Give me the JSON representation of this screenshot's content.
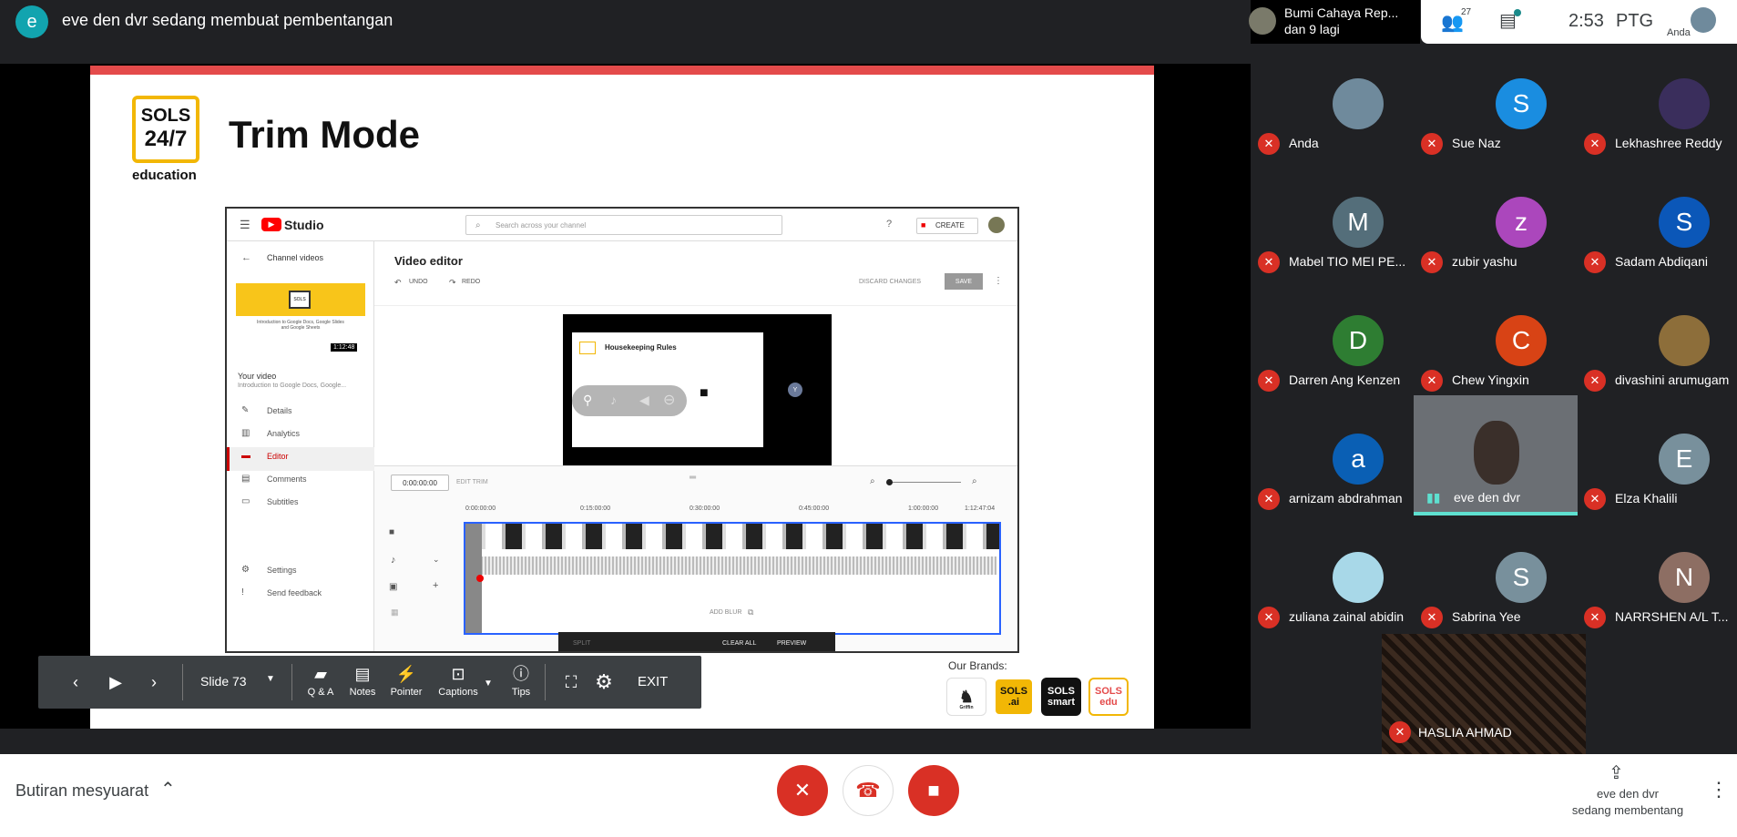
{
  "header": {
    "presenter_initial": "e",
    "presenter_title": "eve den dvr sedang membuat pembentangan"
  },
  "slide": {
    "logo_line1": "SOLS",
    "logo_line2": "24/7",
    "logo_caption": "education",
    "title": "Trim Mode",
    "brands_label": "Our Brands:",
    "brands": [
      "Griffin",
      "SOLS .ai",
      "SOLS smart",
      "SOLS edu"
    ],
    "studio": {
      "brand": "Studio",
      "search_placeholder": "Search across your channel",
      "create": "CREATE",
      "back": "Channel videos",
      "thumb_time": "1:12:48",
      "thumb_title": "Introduction to Google Docs, Google Slides and Google Sheets",
      "your_video": "Your video",
      "video_desc": "Introduction to Google Docs, Google...",
      "nav": [
        "Details",
        "Analytics",
        "Editor",
        "Comments",
        "Subtitles"
      ],
      "settings": "Settings",
      "feedback": "Send feedback",
      "editor_title": "Video editor",
      "undo": "UNDO",
      "redo": "REDO",
      "discard": "DISCARD CHANGES",
      "save": "SAVE",
      "preview_slide_title": "Housekeeping Rules",
      "timecode": "0:00:00:00",
      "edit_trim": "EDIT TRIM",
      "ticks": [
        "0:00:00:00",
        "0:15:00:00",
        "0:30:00:00",
        "0:45:00:00",
        "1:00:00:00",
        "1:12:47:04"
      ],
      "add_blur": "ADD BLUR",
      "split": "SPLIT",
      "clear_all": "CLEAR ALL",
      "preview": "PREVIEW"
    }
  },
  "toolbar": {
    "slide_label": "Slide 73",
    "qa": "Q & A",
    "notes": "Notes",
    "pointer": "Pointer",
    "captions": "Captions",
    "tips": "Tips",
    "exit": "EXIT"
  },
  "group": {
    "name": "Bumi Cahaya Rep...",
    "more": "dan 9 lagi"
  },
  "topright": {
    "people_count": "27",
    "time": "2:53",
    "period": "PTG",
    "self_label": "Anda"
  },
  "participants": [
    {
      "name": "Anda",
      "initial": "",
      "color": "#6f8a9c"
    },
    {
      "name": "Sue Naz",
      "initial": "S",
      "color": "#1a8de0"
    },
    {
      "name": "Lekhashree Reddy",
      "initial": "",
      "color": "#3a2e5c"
    },
    {
      "name": "Mabel TIO MEI PE...",
      "initial": "M",
      "color": "#546e7a"
    },
    {
      "name": "zubir yashu",
      "initial": "z",
      "color": "#ab47bc"
    },
    {
      "name": "Sadam Abdiqani",
      "initial": "S",
      "color": "#0b57b8"
    },
    {
      "name": "Darren Ang Kenzen",
      "initial": "D",
      "color": "#2e7d32"
    },
    {
      "name": "Chew Yingxin",
      "initial": "C",
      "color": "#d84315"
    },
    {
      "name": "divashini arumugam",
      "initial": "",
      "color": "#8d6e3a"
    },
    {
      "name": "arnizam abdrahman",
      "initial": "a",
      "color": "#0a5fb4"
    },
    {
      "name": "eve den dvr",
      "initial": "",
      "color": "#555"
    },
    {
      "name": "Elza Khalili",
      "initial": "E",
      "color": "#78909c"
    },
    {
      "name": "zuliana zainal abidin",
      "initial": "",
      "color": "#a8d8e8"
    },
    {
      "name": "Sabrina Yee",
      "initial": "S",
      "color": "#78909c"
    },
    {
      "name": "NARRSHEN A/L T...",
      "initial": "N",
      "color": "#8d6e63"
    }
  ],
  "bottom_tile": {
    "name": "HASLIA AHMAD"
  },
  "bottombar": {
    "details": "Butiran mesyuarat",
    "presenting_name": "eve den dvr",
    "presenting_status": "sedang membentang"
  }
}
